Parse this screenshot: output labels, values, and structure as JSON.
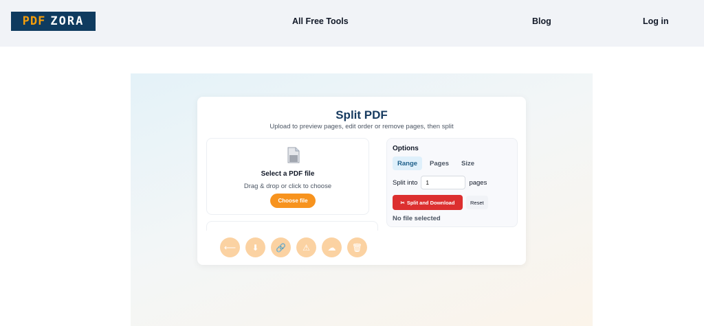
{
  "header": {
    "logo": {
      "part1": "PDF",
      "part2": "ZORA"
    },
    "nav": {
      "tools": "All Free Tools",
      "blog": "Blog",
      "login": "Log in"
    }
  },
  "card": {
    "title": "Split PDF",
    "subtitle": "Upload to preview pages, edit order or remove pages, then split"
  },
  "dropzone": {
    "title": "Select a PDF file",
    "subtitle": "Drag & drop or click to choose",
    "button": "Choose file"
  },
  "toolbar": {
    "icons": [
      "arrow-left-icon",
      "download-icon",
      "link-icon",
      "warning-icon",
      "cloud-icon",
      "trash-icon"
    ],
    "glyphs": [
      "⟵",
      "⬇",
      "🔗",
      "⚠",
      "☁",
      "🗑"
    ]
  },
  "options": {
    "title": "Options",
    "tabs": [
      "Range",
      "Pages",
      "Size"
    ],
    "active_tab": "Range",
    "split_label": "Split into",
    "split_value": "1",
    "split_unit": "pages",
    "split_button": "Split and Download",
    "reset_button": "Reset",
    "status": "No file selected"
  },
  "colors": {
    "accent": "#f7931e",
    "danger": "#dc2f2f",
    "brand": "#0f3b5f",
    "title": "#163a5f"
  }
}
